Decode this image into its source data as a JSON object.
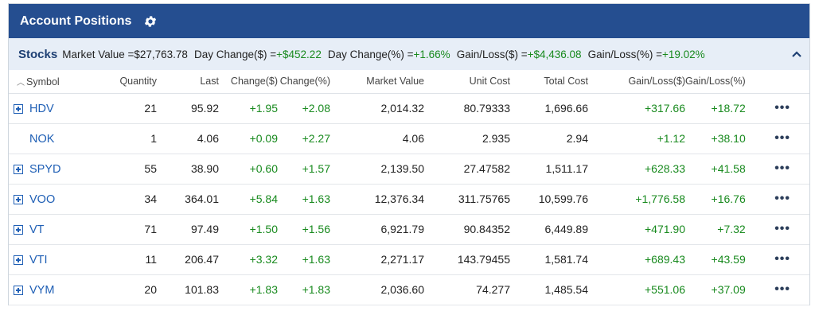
{
  "header": {
    "title": "Account Positions",
    "settings_icon": "gear-icon"
  },
  "summary": {
    "section": "Stocks",
    "market_value_label": "Market Value = ",
    "market_value": "$27,763.78",
    "day_change_label": "Day Change($) = ",
    "day_change": "+$452.22",
    "day_change_pct_label": "Day Change(%) = ",
    "day_change_pct": "+1.66%",
    "gain_loss_label": "Gain/Loss($) = ",
    "gain_loss": "+$4,436.08",
    "gain_loss_pct_label": "Gain/Loss(%) = ",
    "gain_loss_pct": "+19.02%",
    "collapse_icon": "chevron-up-icon"
  },
  "columns": {
    "symbol": "Symbol",
    "quantity": "Quantity",
    "last": "Last",
    "change": "Change($)",
    "change_pct": "Change(%)",
    "market_value": "Market Value",
    "unit_cost": "Unit Cost",
    "total_cost": "Total Cost",
    "gain_loss": "Gain/Loss($)",
    "gain_loss_pct": "Gain/Loss(%)"
  },
  "colors": {
    "header_bg": "#254e90",
    "summary_bg": "#e7eef7",
    "positive": "#188a1e",
    "link": "#1f5fb5"
  },
  "rows": [
    {
      "symbol": "HDV",
      "expandable": true,
      "quantity": "21",
      "last": "95.92",
      "change": "+1.95",
      "change_pct": "+2.08",
      "market_value": "2,014.32",
      "unit_cost": "80.79333",
      "total_cost": "1,696.66",
      "gain_loss": "+317.66",
      "gain_loss_pct": "+18.72"
    },
    {
      "symbol": "NOK",
      "expandable": false,
      "quantity": "1",
      "last": "4.06",
      "change": "+0.09",
      "change_pct": "+2.27",
      "market_value": "4.06",
      "unit_cost": "2.935",
      "total_cost": "2.94",
      "gain_loss": "+1.12",
      "gain_loss_pct": "+38.10"
    },
    {
      "symbol": "SPYD",
      "expandable": true,
      "quantity": "55",
      "last": "38.90",
      "change": "+0.60",
      "change_pct": "+1.57",
      "market_value": "2,139.50",
      "unit_cost": "27.47582",
      "total_cost": "1,511.17",
      "gain_loss": "+628.33",
      "gain_loss_pct": "+41.58"
    },
    {
      "symbol": "VOO",
      "expandable": true,
      "quantity": "34",
      "last": "364.01",
      "change": "+5.84",
      "change_pct": "+1.63",
      "market_value": "12,376.34",
      "unit_cost": "311.75765",
      "total_cost": "10,599.76",
      "gain_loss": "+1,776.58",
      "gain_loss_pct": "+16.76"
    },
    {
      "symbol": "VT",
      "expandable": true,
      "quantity": "71",
      "last": "97.49",
      "change": "+1.50",
      "change_pct": "+1.56",
      "market_value": "6,921.79",
      "unit_cost": "90.84352",
      "total_cost": "6,449.89",
      "gain_loss": "+471.90",
      "gain_loss_pct": "+7.32"
    },
    {
      "symbol": "VTI",
      "expandable": true,
      "quantity": "11",
      "last": "206.47",
      "change": "+3.32",
      "change_pct": "+1.63",
      "market_value": "2,271.17",
      "unit_cost": "143.79455",
      "total_cost": "1,581.74",
      "gain_loss": "+689.43",
      "gain_loss_pct": "+43.59"
    },
    {
      "symbol": "VYM",
      "expandable": true,
      "quantity": "20",
      "last": "101.83",
      "change": "+1.83",
      "change_pct": "+1.83",
      "market_value": "2,036.60",
      "unit_cost": "74.277",
      "total_cost": "1,485.54",
      "gain_loss": "+551.06",
      "gain_loss_pct": "+37.09"
    }
  ],
  "row_actions_icon": "more-horizontal-icon"
}
